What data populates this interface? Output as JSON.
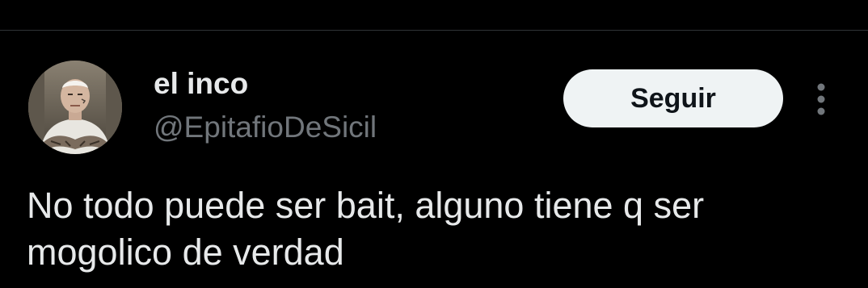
{
  "tweet": {
    "author": {
      "display_name": "el inco",
      "handle": "@EpitafioDeSicil",
      "avatar_icon": "profile-photo"
    },
    "follow_button_label": "Seguir",
    "more_icon": "more-options-vertical-icon",
    "text": "No todo puede ser bait, alguno tiene q ser mogolico de verdad"
  },
  "colors": {
    "background": "#000000",
    "text_primary": "#e7e9ea",
    "text_secondary": "#71767b",
    "button_bg": "#eff3f4",
    "button_text": "#0f1419",
    "divider": "#2f3336"
  }
}
